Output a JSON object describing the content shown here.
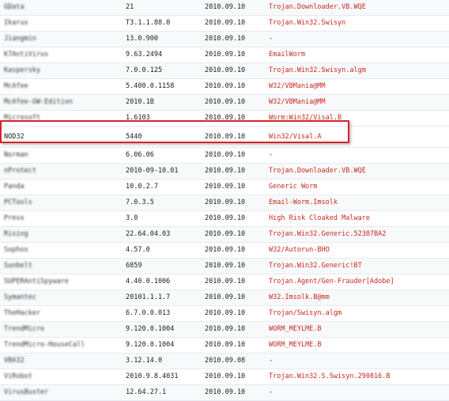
{
  "scan_results": [
    {
      "engine": "GData",
      "version": "21",
      "date": "2010.09.10",
      "result": "Trojan.Downloader.VB.WQE",
      "detected": true,
      "blurred": true
    },
    {
      "engine": "Ikarus",
      "version": "T3.1.1.88.0",
      "date": "2010.09.10",
      "result": "Trojan.Win32.Swisyn",
      "detected": true,
      "blurred": true
    },
    {
      "engine": "Jiangmin",
      "version": "13.0.900",
      "date": "2010.09.10",
      "result": "-",
      "detected": false,
      "blurred": true
    },
    {
      "engine": "K7AntiVirus",
      "version": "9.63.2494",
      "date": "2010.09.10",
      "result": "EmailWorm",
      "detected": true,
      "blurred": true
    },
    {
      "engine": "Kaspersky",
      "version": "7.0.0.125",
      "date": "2010.09.10",
      "result": "Trojan.Win32.Swisyn.algm",
      "detected": true,
      "blurred": true
    },
    {
      "engine": "McAfee",
      "version": "5.400.0.1158",
      "date": "2010.09.10",
      "result": "W32/VBMania@MM",
      "detected": true,
      "blurred": true
    },
    {
      "engine": "McAfee-GW-Edition",
      "version": "2010.1B",
      "date": "2010.09.10",
      "result": "W32/VBMania@MM",
      "detected": true,
      "blurred": true
    },
    {
      "engine": "Microsoft",
      "version": "1.6103",
      "date": "2010.09.10",
      "result": "Worm:Win32/Visal.B",
      "detected": true,
      "blurred": true
    },
    {
      "engine": "NOD32",
      "version": "5440",
      "date": "2010.09.10",
      "result": "Win32/Visal.A",
      "detected": true,
      "blurred": false,
      "highlighted": true
    },
    {
      "engine": "Norman",
      "version": "6.06.06",
      "date": "2010.09.10",
      "result": "-",
      "detected": false,
      "blurred": true
    },
    {
      "engine": "nProtect",
      "version": "2010-09-10.01",
      "date": "2010.09.10",
      "result": "Trojan.Downloader.VB.WQE",
      "detected": true,
      "blurred": true
    },
    {
      "engine": "Panda",
      "version": "10.0.2.7",
      "date": "2010.09.10",
      "result": "Generic Worm",
      "detected": true,
      "blurred": true
    },
    {
      "engine": "PCTools",
      "version": "7.0.3.5",
      "date": "2010.09.10",
      "result": "Email-Worm.Imsolk",
      "detected": true,
      "blurred": true
    },
    {
      "engine": "Prevx",
      "version": "3.0",
      "date": "2010.09.10",
      "result": "High Risk Cloaked Malware",
      "detected": true,
      "blurred": true
    },
    {
      "engine": "Rising",
      "version": "22.64.04.03",
      "date": "2010.09.10",
      "result": "Trojan.Win32.Generic.52307BA2",
      "detected": true,
      "blurred": true
    },
    {
      "engine": "Sophos",
      "version": "4.57.0",
      "date": "2010.09.10",
      "result": "W32/Autorun-BHO",
      "detected": true,
      "blurred": true
    },
    {
      "engine": "Sunbelt",
      "version": "6859",
      "date": "2010.09.10",
      "result": "Trojan.Win32.Generic!BT",
      "detected": true,
      "blurred": true
    },
    {
      "engine": "SUPERAntiSpyware",
      "version": "4.40.0.1006",
      "date": "2010.09.10",
      "result": "Trojan.Agent/Gen-Frauder[Adobe]",
      "detected": true,
      "blurred": true
    },
    {
      "engine": "Symantec",
      "version": "20101.1.1.7",
      "date": "2010.09.10",
      "result": "W32.Imsolk.B@mm",
      "detected": true,
      "blurred": true
    },
    {
      "engine": "TheHacker",
      "version": "6.7.0.0.013",
      "date": "2010.09.10",
      "result": "Trojan/Swisyn.algm",
      "detected": true,
      "blurred": true
    },
    {
      "engine": "TrendMicro",
      "version": "9.120.0.1004",
      "date": "2010.09.10",
      "result": "WORM_MEYLME.B",
      "detected": true,
      "blurred": true
    },
    {
      "engine": "TrendMicro-HouseCall",
      "version": "9.120.0.1004",
      "date": "2010.09.10",
      "result": "WORM_MEYLME.B",
      "detected": true,
      "blurred": true
    },
    {
      "engine": "VBA32",
      "version": "3.12.14.0",
      "date": "2010.09.08",
      "result": "-",
      "detected": false,
      "blurred": true
    },
    {
      "engine": "ViRobot",
      "version": "2010.9.8.4031",
      "date": "2010.09.10",
      "result": "Trojan.Win32.S.Swisyn.290816.B",
      "detected": true,
      "blurred": true
    },
    {
      "engine": "VirusBuster",
      "version": "12.64.27.1",
      "date": "2010.09.10",
      "result": "-",
      "detected": false,
      "blurred": true
    }
  ],
  "colors": {
    "detection_text": "#c8281e",
    "clean_text": "#333333",
    "highlight_border": "#d8232a"
  }
}
